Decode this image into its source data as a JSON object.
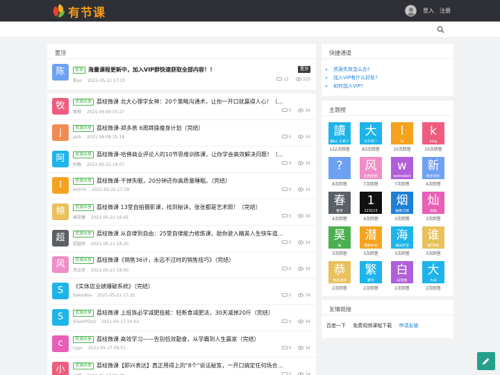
{
  "brand": {
    "name": "有节课"
  },
  "header": {
    "login": "登入",
    "register": "注册"
  },
  "pinned": {
    "heading": "置顶",
    "item": {
      "avatar": "陈",
      "avatar_color": "#6fa1f2",
      "tag": "智慧",
      "title": "海量课程更新中，加入VIP群快速获取全部内容！！",
      "author": "陈sir",
      "date": "2021-05-12 17:25",
      "badge": "置顶",
      "comments": "13",
      "views": "325"
    }
  },
  "posts": [
    {
      "avatar": "牧",
      "color": "#ef5c7f",
      "tag": "资源共享",
      "title": "荔枝微课 北大心理学女神：20个策略沟通术，让你一开口就赢得人心！（...",
      "author": "牧狼",
      "date": "2021-06-09 15:27",
      "comments": "0",
      "views": "34"
    },
    {
      "avatar": "j",
      "color": "#f08c53",
      "tag": "资源共享",
      "title": "荔枝微课-郑多燕 6周跳操瘦身计划（完结）",
      "author": "jack",
      "date": "2021-06-09 15:18",
      "comments": "0",
      "views": "34"
    },
    {
      "avatar": "阿",
      "color": "#1eb4ea",
      "tag": "资源共享",
      "title": "荔枝微课-哈佛商业评论人的10节思维训练课，让你学会高效解决问题！（...",
      "author": "阿飘",
      "date": "2021-05-22 18:07",
      "comments": "0",
      "views": "34"
    },
    {
      "avatar": "l",
      "color": "#f5a31f",
      "tag": "资源共享",
      "title": "荔枝微课-干掉失眠，20分钟还你高质量睡眠。（完结）",
      "author": "lm079",
      "date": "2021-05-22 17:39",
      "comments": "0",
      "views": "34"
    },
    {
      "avatar": "棉",
      "color": "#e8c15c",
      "tag": "资源共享",
      "title": "荔枝微课 13堂自拍摄影课，找到秘诀，张张都是艺术照！（完结）",
      "author": "棉花糖",
      "date": "2021-05-22 16:45",
      "comments": "0",
      "views": "34"
    },
    {
      "avatar": "超",
      "color": "#5b5f66",
      "tag": "资源共享",
      "title": "荔枝微课 从自律到自由：25堂自律能力修炼课，助你驶入精英人生快车道...",
      "author": "超越改",
      "date": "2021-05-21 18:20",
      "comments": "0",
      "views": "34"
    },
    {
      "avatar": "风",
      "color": "#ef8ec8",
      "tag": "资源共享",
      "title": "荔枝微课《销售36计，永远不过时的销售技巧》（完结）",
      "author": "风议员",
      "date": "2021-05-21 18:00",
      "comments": "0",
      "views": "34"
    },
    {
      "avatar": "S",
      "color": "#1eb4ea",
      "tag": "",
      "title": "《实体店业绩爆破系统》（完结）",
      "author": "Saloolloo",
      "date": "2021-05-21 17:35",
      "comments": "0",
      "views": "34"
    },
    {
      "avatar": "S",
      "color": "#1eb4ea",
      "tag": "资源共享",
      "title": "荔枝微课 上班族必学减肥技能：轻断食减肥法，30天减掉20斤（完结）",
      "author": "SilverPOLO",
      "date": "2021-05-17 10:02",
      "comments": "0",
      "views": "34"
    },
    {
      "avatar": "c",
      "color": "#e85fb6",
      "tag": "资源共享",
      "title": "荔枝微课 高效学习——告别低效勤奋，从学霸到人生赢家（完结）",
      "author": "cypc",
      "date": "2021-05-17 09:51",
      "comments": "0",
      "views": "34"
    },
    {
      "avatar": "小",
      "color": "#ef5c7f",
      "tag": "资源共享",
      "title": "荔枝微课【即兴表达】真正用得上的\"8个\"说话秘笈，一开口搞定任何场合（...",
      "author": "小桐",
      "date": "2021-05-17 09:38",
      "comments": "0",
      "views": "34"
    }
  ],
  "quick": {
    "heading": "快捷通道",
    "links": [
      "资源失效怎么办?",
      "加入VIP有什么好处?",
      "如何加入VIP?"
    ]
  },
  "leaders": {
    "heading": "主题榜",
    "tiles": [
      {
        "ch": "讀",
        "name": "讀oo 彡累了",
        "count": "122次回答",
        "color": "#1eb4ea"
      },
      {
        "ch": "大",
        "name": "大牛初一",
        "count": "83次回答",
        "color": "#1eb4ea"
      },
      {
        "ch": "l",
        "name": "lx",
        "count": "10次回答",
        "color": "#f5a31f"
      },
      {
        "ch": "k",
        "name": "king",
        "count": "10次回答",
        "color": "#ef5c7f"
      },
      {
        "ch": "?",
        "name": "",
        "count": "8次回答",
        "color": "#6fa1f2"
      },
      {
        "ch": "风",
        "name": "风雨无阻",
        "count": "7次回答",
        "color": "#ef8ec8"
      },
      {
        "ch": "w",
        "name": "webrabbit",
        "count": "7次回答",
        "color": "#b05fd9"
      },
      {
        "ch": "新",
        "name": "新年快乐",
        "count": "4次回答",
        "color": "#6fa1f2"
      },
      {
        "ch": "春",
        "name": "春天",
        "count": "4次回答",
        "color": "#5b5f66"
      },
      {
        "ch": "1",
        "name": "123123",
        "count": "4次回答",
        "color": "#111111"
      },
      {
        "ch": "烟",
        "name": "烟雨江南",
        "count": "3次回答",
        "color": "#1e7fd6"
      },
      {
        "ch": "灿",
        "name": "灿灿",
        "count": "3次回答",
        "color": "#e85fb6"
      },
      {
        "ch": "昊",
        "name": "昊",
        "count": "3次回答",
        "color": "#4caf50"
      },
      {
        "ch": "潜",
        "name": "潜移默化",
        "count": "3次回答",
        "color": "#f5a31f"
      },
      {
        "ch": "海",
        "name": "海阔天空",
        "count": "3次回答",
        "color": "#1eb4ea"
      },
      {
        "ch": "谁",
        "name": "谁TM买",
        "count": "3次回答",
        "color": "#e8c15c"
      },
      {
        "ch": "恭",
        "name": "恭喜发财",
        "count": "2次回答",
        "color": "#e8c15c"
      },
      {
        "ch": "繁",
        "name": "繁华",
        "count": "2次回答",
        "color": "#1eb4ea"
      },
      {
        "ch": "白",
        "name": "白鸽鱼",
        "count": "2次回答",
        "color": "#b05fd9"
      },
      {
        "ch": "大",
        "name": "大白",
        "count": "2次回答",
        "color": "#1eb4ea"
      }
    ]
  },
  "friends": {
    "heading": "友情链接",
    "links": [
      "百度一下",
      "免费视频课程下载"
    ],
    "apply": "申请友链"
  },
  "colors": {
    "topbar": "#2f3035",
    "accent": "#1e7fd6",
    "fab": "#25a08c",
    "tag": "#4caf50"
  }
}
